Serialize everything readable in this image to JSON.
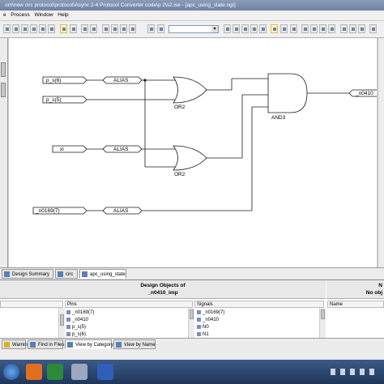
{
  "window": {
    "title": "om\\new circ protocol\\protocol\\Async 2-4 Protocol Converter code\\p 2\\s2.ise - [apc_using_state.ngr]"
  },
  "menu": {
    "items": [
      "e",
      "Process",
      "Window",
      "Help"
    ]
  },
  "toolbar": {
    "icons": [
      "open-icon",
      "save-icon",
      "print-icon",
      "cut-icon",
      "copy-icon",
      "paste-icon",
      "undo-icon",
      "redo-icon",
      "delete-icon",
      "zoom-fit-icon",
      "binoculars-icon",
      "find-icon",
      "zoom-in-icon",
      "zoom-out-icon",
      "pointer-icon",
      "text-icon"
    ]
  },
  "schematic": {
    "inputs": [
      "p_s(6)",
      "p_s(5)",
      "xi",
      "_n0169(7)"
    ],
    "alias_label": "ALIAS",
    "gates": [
      "OR2",
      "OR2",
      "AND3"
    ],
    "output": "_n0410"
  },
  "doc_tabs": [
    "Design Summary",
    "circ",
    "apc_using_state"
  ],
  "design_objects": {
    "title_line1": "Design Objects of",
    "title_line2": "_n0410_imp",
    "right_title_line1": "N",
    "right_title_line2": "No obj",
    "pins_header": "Pins",
    "pins": [
      "_n0169(7)",
      "_n0410",
      "p_s(5)",
      "p_s(6)"
    ],
    "signals_header": "Signals",
    "signals": [
      "_n0169(7)",
      "_n0410",
      "N0",
      "N1"
    ],
    "name_header": "Name"
  },
  "bottom_tabs": [
    "Warnings",
    "Find in Files",
    "View by Category",
    "View by Name"
  ],
  "colors": {
    "wire": "#1a1a1a",
    "titlebar": "#7d90b0",
    "taskbar": "#2a4670"
  }
}
